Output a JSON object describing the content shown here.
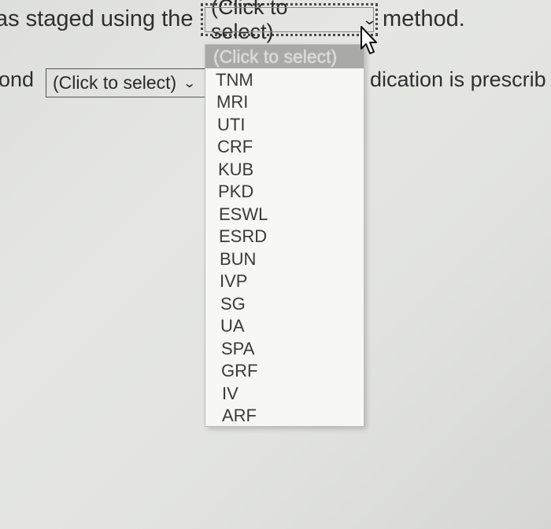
{
  "sentence1": {
    "prefix": "as staged using the",
    "select_value": "(Click to select)",
    "suffix": "method."
  },
  "sentence2": {
    "prefix": "ond",
    "select_value": "(Click to select)",
    "trail": "dication is prescrib"
  },
  "dropdown": {
    "header": "(Click to select)",
    "options": [
      "TNM",
      "MRI",
      "UTI",
      "CRF",
      "KUB",
      "PKD",
      "ESWL",
      "ESRD",
      "BUN",
      "IVP",
      "SG",
      "UA",
      "SPA",
      "GRF",
      "IV",
      "ARF"
    ]
  },
  "icons": {
    "select_chevron": "chevron-down-icon",
    "cursor": "mouse-pointer-icon"
  },
  "colors": {
    "background": "#e2e3df",
    "dropdown_bg": "#f7f7f6",
    "dropdown_header_bg": "#a9aaa8"
  }
}
